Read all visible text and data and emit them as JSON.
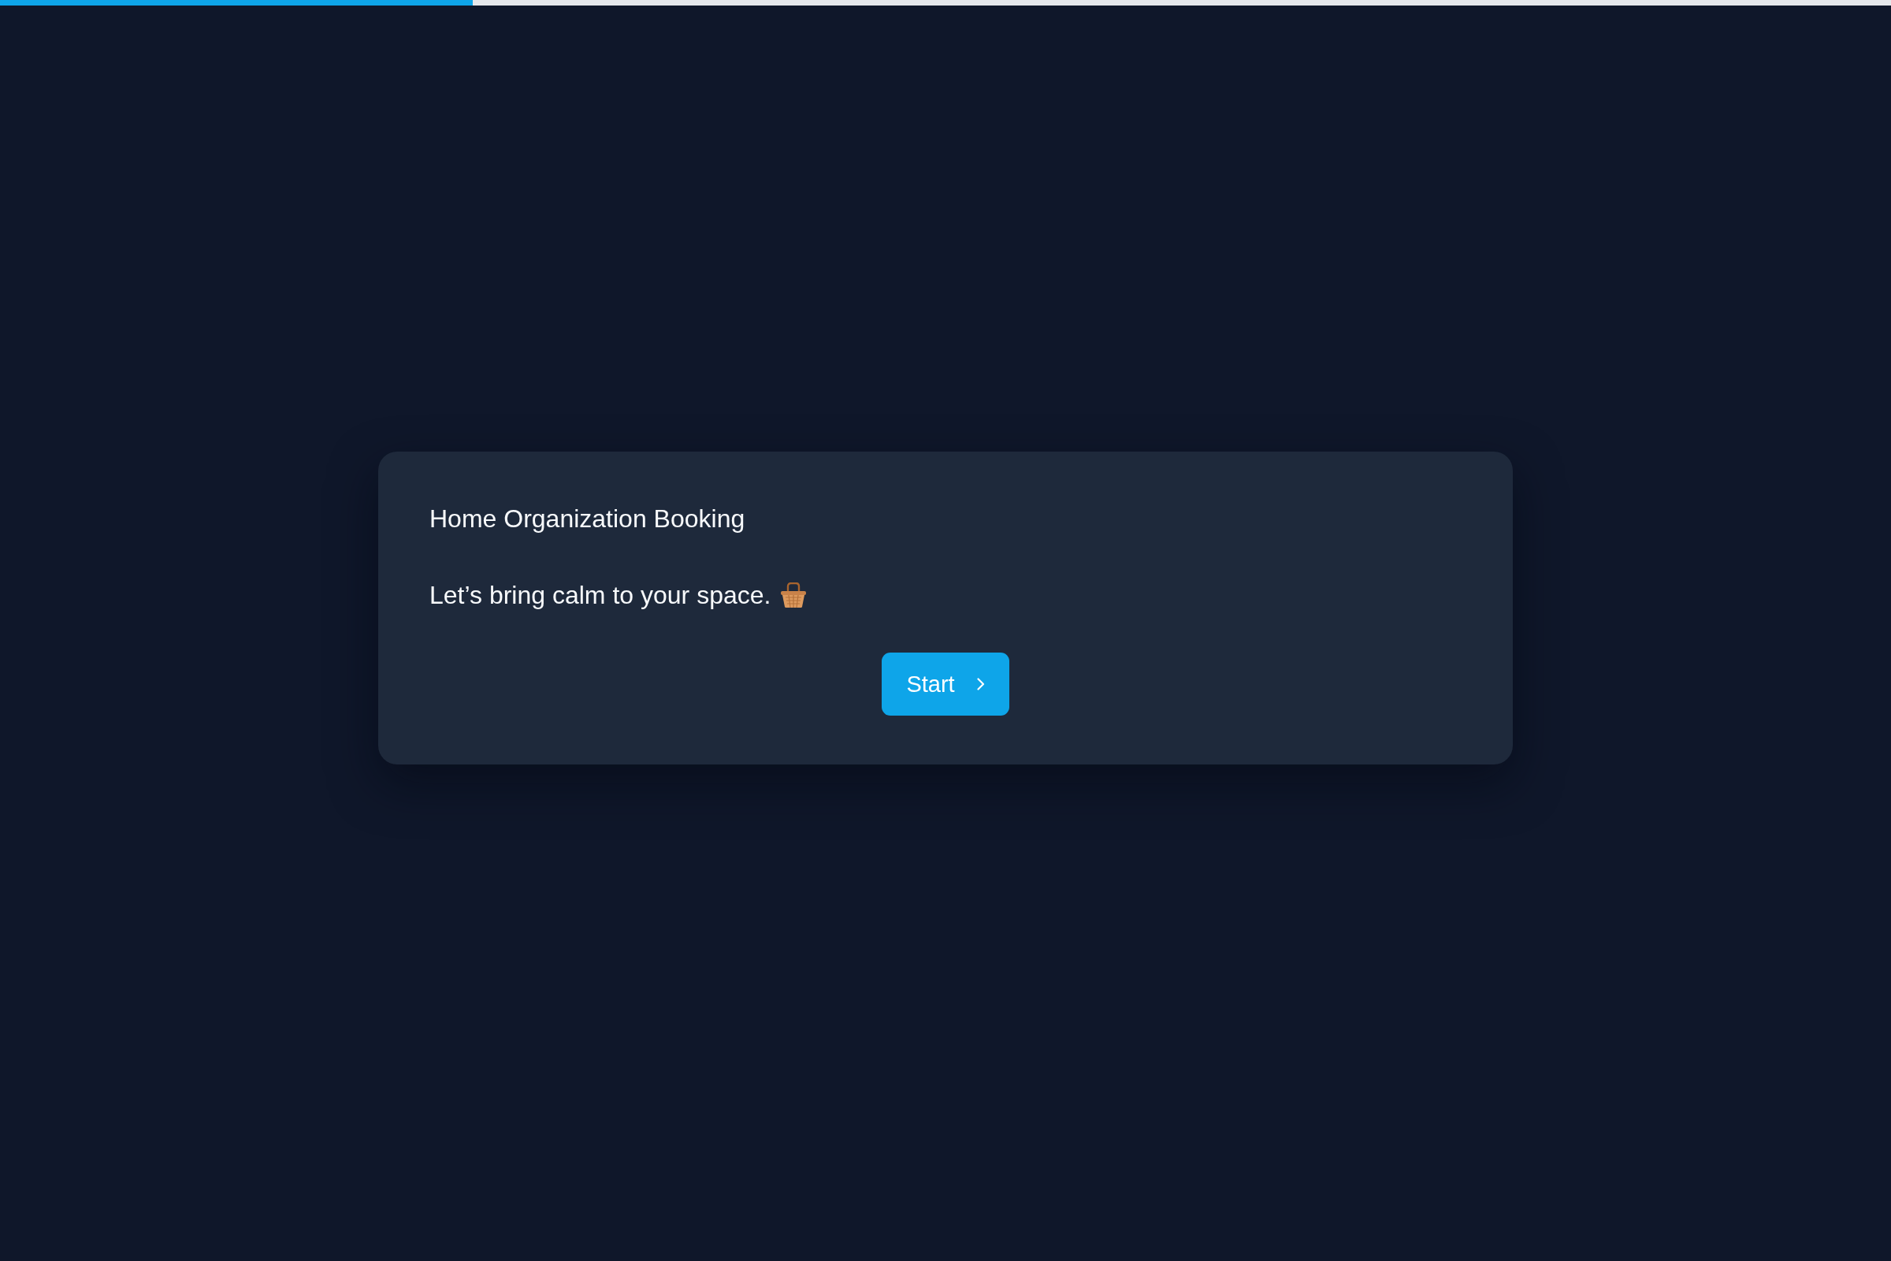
{
  "progress": {
    "level": 0.25
  },
  "card": {
    "title": "Home Organization Booking",
    "message": "Let’s bring calm to your space.",
    "button": {
      "label": "Start"
    }
  }
}
